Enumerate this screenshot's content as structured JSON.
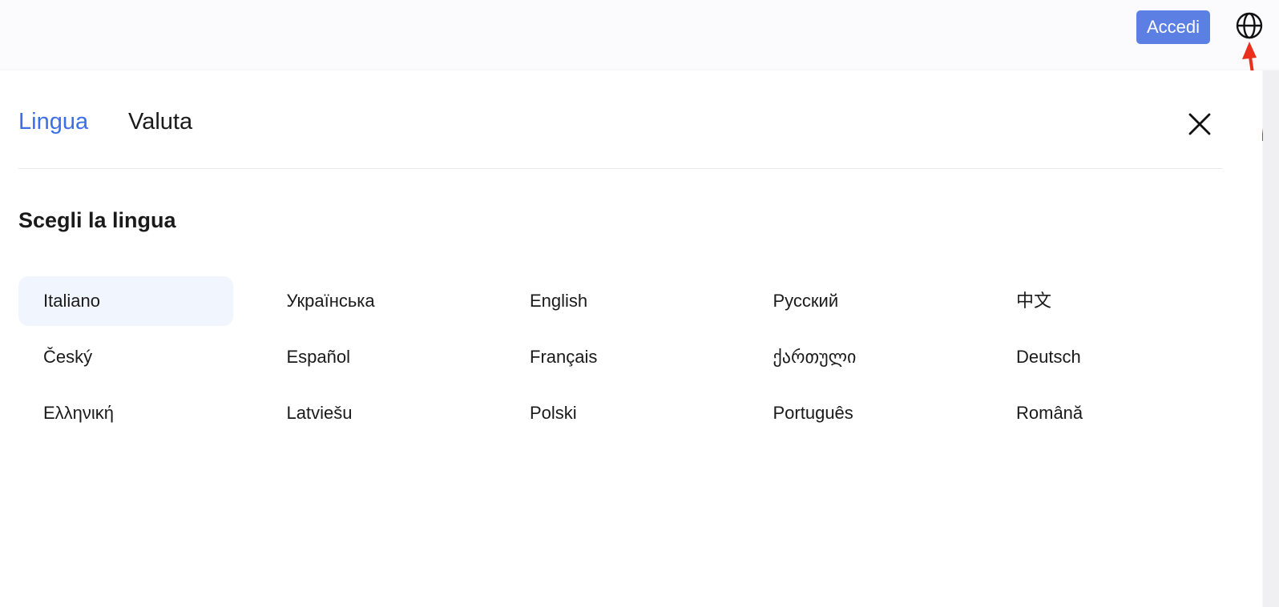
{
  "header": {
    "login_label": "Accedi",
    "globe_icon": "globe-icon",
    "accent": "#5b7fe3"
  },
  "settings": {
    "tabs": [
      {
        "label": "Lingua",
        "active": true
      },
      {
        "label": "Valuta",
        "active": false
      }
    ],
    "close_icon": "close-icon",
    "heading": "Scegli la lingua",
    "active_color": "#3d6fe6",
    "languages": [
      "Italiano",
      "Українська",
      "English",
      "Русский",
      "中文",
      "Český",
      "Español",
      "Français",
      "ქართული",
      "Deutsch",
      "Ελληνική",
      "Latviešu",
      "Polski",
      "Português",
      "Română"
    ],
    "selected_language": "Italiano",
    "selected_bg": "#f1f5fd"
  },
  "annotation": {
    "arrow_color": "#e8301c"
  }
}
